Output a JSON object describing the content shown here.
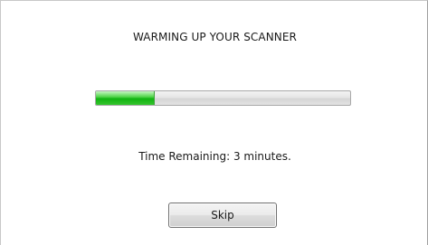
{
  "dialog": {
    "title": "WARMING UP YOUR SCANNER",
    "progress": {
      "fraction": 0.23
    },
    "time_remaining": "Time Remaining: 3 minutes.",
    "skip_label": "Skip"
  },
  "colors": {
    "progress_fill": "#11b411",
    "progress_track": "#e2e2e2"
  }
}
